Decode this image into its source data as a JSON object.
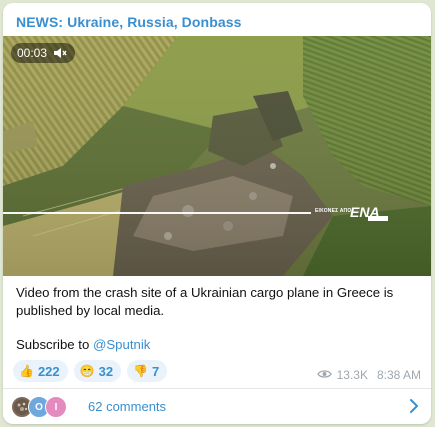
{
  "channel": {
    "title": "NEWS: Ukraine, Russia, Donbass"
  },
  "video": {
    "duration": "00:03",
    "muted_icon": "muted-speaker-icon",
    "watermark_small": "ΕΙΚΟΝΕΣ ΑΠΟ",
    "watermark_logo": "ΕΝΑ"
  },
  "post": {
    "caption": "Video from the crash site of a Ukrainian cargo plane in Greece is published by local media.",
    "subscribe_prefix": "Subscribe to ",
    "subscribe_mention": "@Sputnik"
  },
  "reactions": [
    {
      "emoji": "👍",
      "icon": "thumbs-up-icon",
      "count": "222"
    },
    {
      "emoji": "😁",
      "icon": "grin-icon",
      "count": "32"
    },
    {
      "emoji": "👎",
      "icon": "thumbs-down-icon",
      "count": "7"
    }
  ],
  "meta": {
    "views": "13.3K",
    "time": "8:38 AM",
    "views_icon": "eye-icon"
  },
  "comments": {
    "label": "62 comments",
    "avatars": [
      {
        "letter": "",
        "color": "#7d6a5a"
      },
      {
        "letter": "O",
        "color": "#6fa8dc"
      },
      {
        "letter": "I",
        "color": "#e38bbf"
      }
    ]
  },
  "colors": {
    "accent": "#3a8fcf",
    "background": "#dfe7d3"
  }
}
